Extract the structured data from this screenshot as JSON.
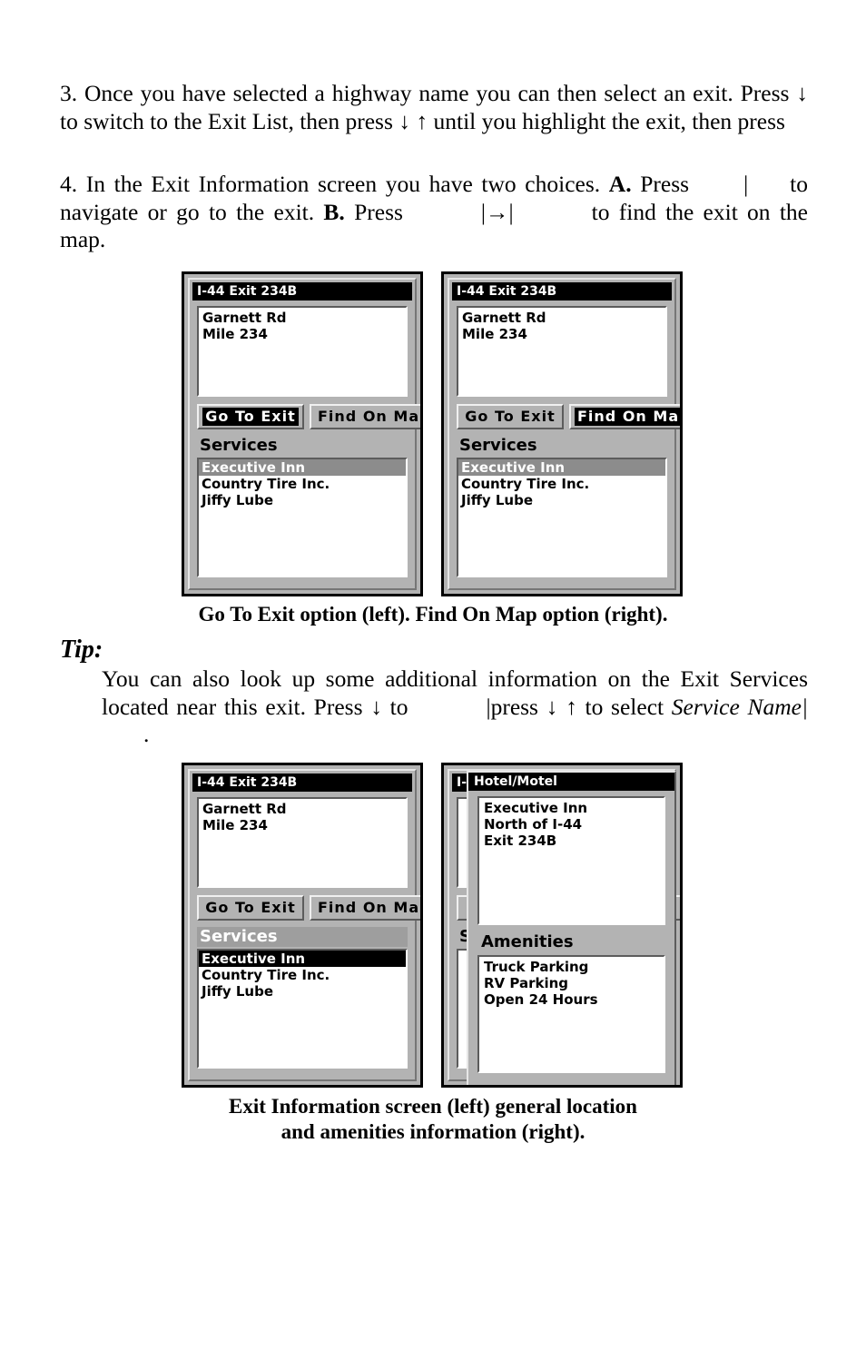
{
  "document": {
    "steps": [
      {
        "id": "step3",
        "number": "3.",
        "text_a": "Once you have selected a highway name you can then select an exit. Press ",
        "arrow_down": "↓",
        "text_b": " to switch to the Exit List, then press ",
        "arrow_down2": "↓",
        "arrow_up": "↑",
        "text_c": " until you highlight the exit, then press"
      },
      {
        "id": "step4",
        "number": "4.",
        "text_a": "In the Exit Information screen you have two choices. ",
        "bold_a": "A.",
        "text_b": " Press",
        "key_a": "|",
        "text_c": "to navigate or go to the exit. ",
        "bold_b": "B.",
        "text_d": " Press",
        "key_b": "|→|",
        "text_e": "to find the exit on the map."
      }
    ],
    "caption_top": "Go To Exit option (left). Find On Map option (right).",
    "caption_bottom_line1": "Exit Information screen (left) general location",
    "caption_bottom_line2": "and amenities information (right).",
    "tip": {
      "heading": "Tip:",
      "text_a": "You can also look up some additional information on the Exit Services located near this exit. Press ",
      "arrow_down": "↓",
      "text_b": " to",
      "key_a": "|press ",
      "arrow_down2": "↓",
      "arrow_up": "↑",
      "text_c": " to select ",
      "italic_a": "Service Name|",
      "text_d": "."
    }
  },
  "screens": {
    "top_left": {
      "title": "I-44 Exit 234B",
      "info_lines": [
        "Garnett Rd",
        "Mile 234"
      ],
      "buttons": [
        {
          "label": "Go To Exit",
          "selected": true
        },
        {
          "label": "Find On Map",
          "selected": false
        }
      ],
      "section_header": "Services",
      "section_header_highlighted": false,
      "list_items": [
        {
          "label": "Executive Inn",
          "highlight": "gray"
        },
        {
          "label": "Country Tire Inc.",
          "highlight": "none"
        },
        {
          "label": "Jiffy Lube",
          "highlight": "none"
        }
      ]
    },
    "top_right": {
      "title": "I-44 Exit 234B",
      "info_lines": [
        "Garnett Rd",
        "Mile 234"
      ],
      "buttons": [
        {
          "label": "Go To Exit",
          "selected": false
        },
        {
          "label": "Find On Map",
          "selected": true
        }
      ],
      "section_header": "Services",
      "section_header_highlighted": false,
      "list_items": [
        {
          "label": "Executive Inn",
          "highlight": "gray"
        },
        {
          "label": "Country Tire Inc.",
          "highlight": "none"
        },
        {
          "label": "Jiffy Lube",
          "highlight": "none"
        }
      ]
    },
    "bottom_left": {
      "title": "I-44 Exit 234B",
      "info_lines": [
        "Garnett Rd",
        "Mile 234"
      ],
      "buttons": [
        {
          "label": "Go To Exit",
          "selected": false
        },
        {
          "label": "Find On Map",
          "selected": false
        }
      ],
      "section_header": "Services",
      "section_header_highlighted": true,
      "list_items": [
        {
          "label": "Executive Inn",
          "highlight": "black"
        },
        {
          "label": "Country Tire Inc.",
          "highlight": "none"
        },
        {
          "label": "Jiffy Lube",
          "highlight": "none"
        }
      ]
    },
    "bottom_right": {
      "background_title_fragment": "I-",
      "background_section_fragment": "S",
      "overlay": {
        "title": "Hotel/Motel",
        "info_lines": [
          "Executive Inn",
          "North of I-44",
          "Exit 234B"
        ],
        "amenities_header": "Amenities",
        "amenities": [
          "Truck Parking",
          "RV Parking",
          "Open 24 Hours"
        ]
      }
    }
  },
  "colors": {
    "device_body": "#b3b3b3",
    "titlebar_bg": "#000000",
    "titlebar_fg": "#ffffff",
    "highlight_gray": "#8c8c8c",
    "highlight_black": "#000000",
    "screen_white": "#ffffff"
  }
}
